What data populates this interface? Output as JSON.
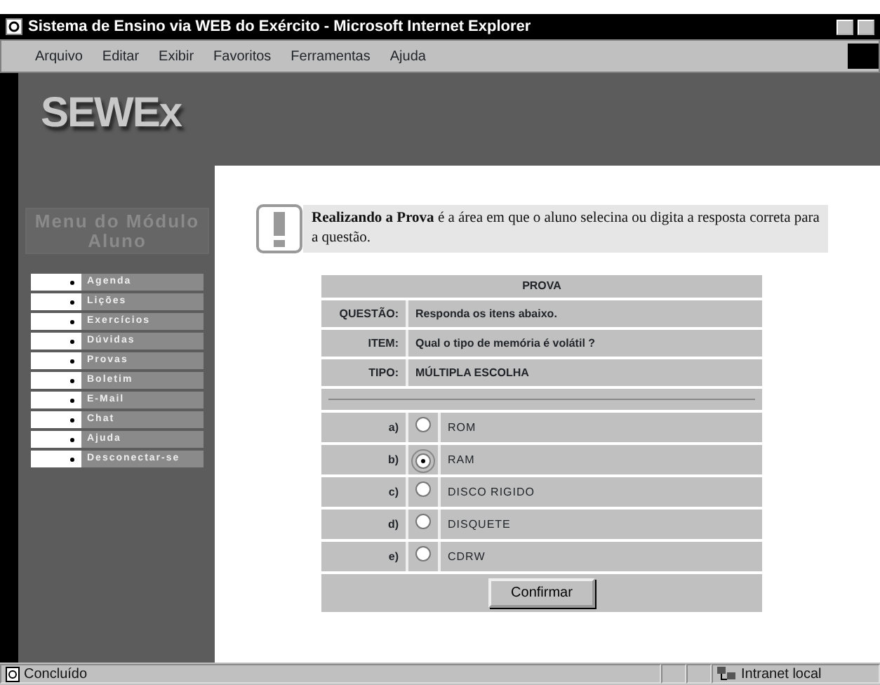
{
  "window": {
    "title": "Sistema de Ensino via WEB do Exército - Microsoft Internet Explorer"
  },
  "menu_bar": [
    "Arquivo",
    "Editar",
    "Exibir",
    "Favoritos",
    "Ferramentas",
    "Ajuda"
  ],
  "logo": "SEWEx",
  "sidebar": {
    "title": "Menu do Módulo Aluno",
    "items": [
      "Agenda",
      "Lições",
      "Exercícios",
      "Dúvidas",
      "Provas",
      "Boletim",
      "E-Mail",
      "Chat",
      "Ajuda",
      "Desconectar-se"
    ]
  },
  "notice": "**Realizando a Prova** é a área em que o aluno selecina ou digita a resposta correta para a questão.",
  "exam": {
    "title": "PROVA",
    "fields": [
      {
        "label": "QUESTÃO:",
        "value": "Responda os itens abaixo."
      },
      {
        "label": "ITEM:",
        "value": "Qual o tipo de memória é volátil ?"
      },
      {
        "label": "TIPO:",
        "value": "MÚLTIPLA ESCOLHA"
      }
    ],
    "options": [
      {
        "letter": "a)",
        "label": "ROM",
        "selected": false
      },
      {
        "letter": "b)",
        "label": "RAM",
        "selected": true
      },
      {
        "letter": "c)",
        "label": "DISCO RIGIDO",
        "selected": false
      },
      {
        "letter": "d)",
        "label": "DISQUETE",
        "selected": false
      },
      {
        "letter": "e)",
        "label": "CDRW",
        "selected": false
      }
    ],
    "button": "Confirmar"
  },
  "status_bar": {
    "text": "Concluído",
    "zone": "Intranet local"
  }
}
